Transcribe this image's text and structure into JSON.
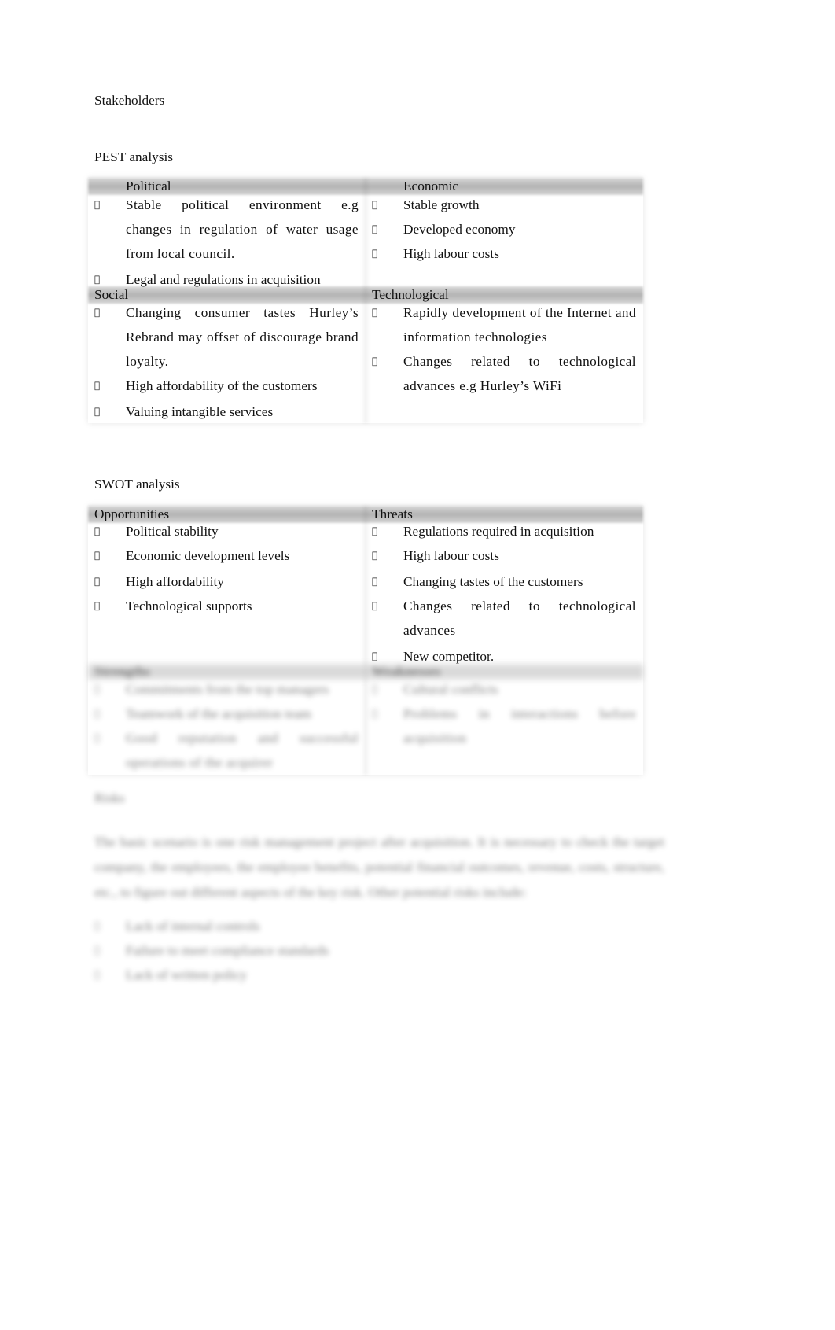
{
  "headings": {
    "stakeholders": "Stakeholders",
    "pest": "PEST analysis",
    "swot": "SWOT analysis",
    "risks": "Risks"
  },
  "bullet_glyph": "",
  "pest": {
    "political": {
      "title": "Political",
      "items": [
        "Stable political environment e.g changes in regulation of water usage from local council.",
        "Legal and regulations in acquisition"
      ]
    },
    "economic": {
      "title": "Economic",
      "items": [
        "Stable growth",
        "Developed economy",
        "High labour costs"
      ]
    },
    "social": {
      "title": "Social",
      "items": [
        "Changing consumer tastes Hurley’s Rebrand may offset of discourage brand loyalty.",
        "High affordability of the customers",
        "Valuing intangible services"
      ]
    },
    "technological": {
      "title": "Technological",
      "items": [
        "Rapidly development of the Internet and information technologies",
        "Changes related to technological advances e.g Hurley’s WiFi"
      ]
    }
  },
  "swot": {
    "opportunities": {
      "title": "Opportunities",
      "items": [
        "Political stability",
        "Economic development levels",
        "High affordability",
        "Technological supports"
      ]
    },
    "threats": {
      "title": "Threats",
      "items": [
        "Regulations required in acquisition",
        "High labour costs",
        "Changing tastes of the customers",
        "Changes related to technological advances",
        "New competitor."
      ]
    },
    "strengths": {
      "title": "Strengths",
      "items": [
        "Commitments from the top managers",
        "Teamwork of the acquisition team",
        "Good reputation and successful operations of the acquirer"
      ]
    },
    "weaknesses": {
      "title": "Weaknesses",
      "items": [
        "Cultural conflicts",
        "Problems in interactions before acquisition"
      ]
    }
  },
  "risks": {
    "paragraph": "The basic scenario is one risk management project after acquisition. It is necessary to check the target company, the employees, the employee benefits, potential financial outcomes, revenue, costs, structure, etc., to figure out different aspects of the key risk. Other potential risks include:",
    "items": [
      "Lack of internal controls",
      "Failure to meet compliance standards",
      "Lack of written policy"
    ]
  }
}
